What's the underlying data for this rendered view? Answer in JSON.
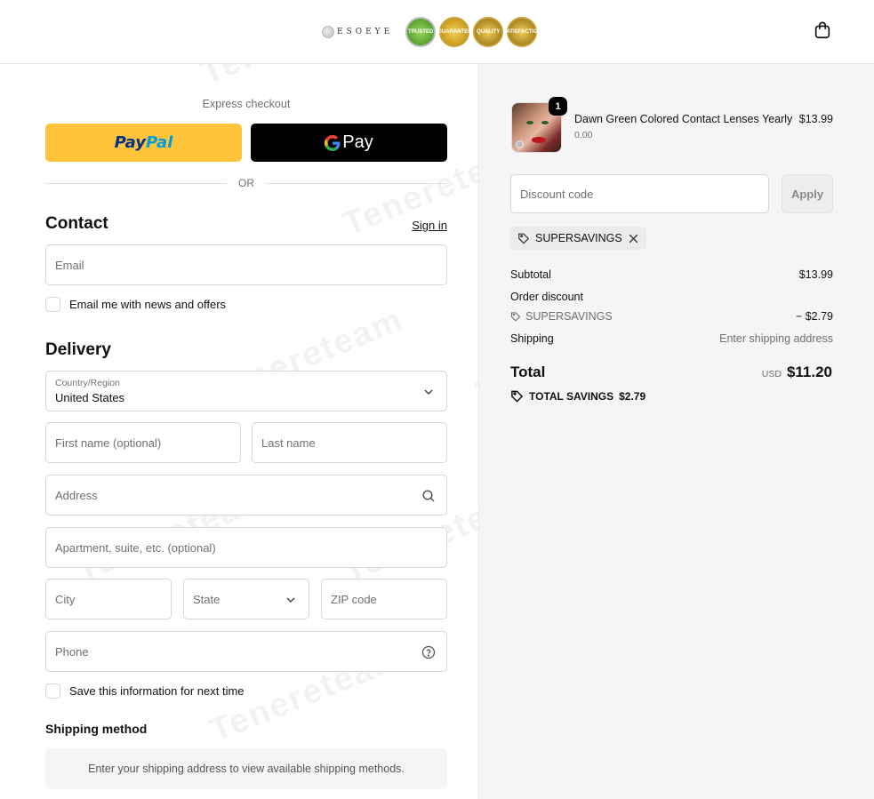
{
  "header": {
    "brand_text": "ESOEYE",
    "badges": [
      "TRUSTED",
      "GUARANTEE",
      "QUALITY",
      "SATISFACTION"
    ],
    "cart_icon": "shopping-bag-icon"
  },
  "express": {
    "label": "Express checkout",
    "paypal_label_1": "Pay",
    "paypal_label_2": "Pal",
    "gpay_label": "Pay",
    "or_label": "OR"
  },
  "contact": {
    "title": "Contact",
    "signin_label": "Sign in",
    "email_placeholder": "Email",
    "newsletter_label": "Email me with news and offers"
  },
  "delivery": {
    "title": "Delivery",
    "country_label": "Country/Region",
    "country_value": "United States",
    "first_name_placeholder": "First name (optional)",
    "last_name_placeholder": "Last name",
    "address_placeholder": "Address",
    "apartment_placeholder": "Apartment, suite, etc. (optional)",
    "city_placeholder": "City",
    "state_placeholder": "State",
    "zip_placeholder": "ZIP code",
    "phone_placeholder": "Phone",
    "save_info_label": "Save this information for next time"
  },
  "shipping_method": {
    "title": "Shipping method",
    "message": "Enter your shipping address to view available shipping methods."
  },
  "summary": {
    "product": {
      "quantity": "1",
      "name": "Dawn Green Colored Contact Lenses Yearly",
      "variant": "0.00",
      "price": "$13.99"
    },
    "discount_placeholder": "Discount code",
    "apply_label": "Apply",
    "applied_code": "SUPERSAVINGS",
    "subtotal_label": "Subtotal",
    "subtotal_value": "$13.99",
    "order_discount_label": "Order discount",
    "discount_code_label": "SUPERSAVINGS",
    "discount_value": "− $2.79",
    "shipping_label": "Shipping",
    "shipping_value": "Enter shipping address",
    "total_label": "Total",
    "total_currency": "USD",
    "total_value": "$11.20",
    "savings_label": "TOTAL SAVINGS",
    "savings_value": "$2.79"
  },
  "watermark": "Tenereteam",
  "colors": {
    "paypal_yellow": "#ffc439",
    "gpay_black": "#000000",
    "summary_bg": "#f5f5f5"
  }
}
